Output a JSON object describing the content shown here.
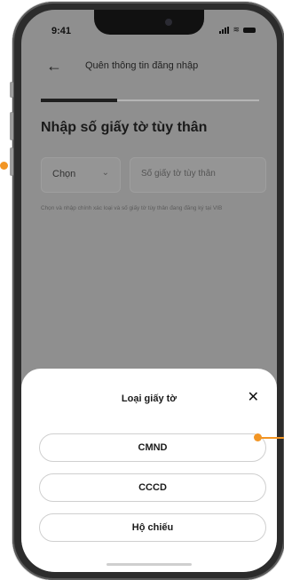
{
  "status_bar": {
    "time": "9:41"
  },
  "header": {
    "title": "Quên thông tin đăng nhập"
  },
  "progress": {
    "fraction": 0.35
  },
  "page": {
    "title": "Nhập số giấy tờ tùy thân"
  },
  "form": {
    "select_value": "Chọn",
    "input_placeholder": "Số giấy tờ tùy thân",
    "helper_text": "Chọn và nhập chính xác loại và số giấy tờ tùy thân đang đăng ký tại VIB"
  },
  "sheet": {
    "title": "Loại giấy tờ",
    "options": [
      {
        "label": "CMND"
      },
      {
        "label": "CCCD"
      },
      {
        "label": "Hộ chiếu"
      }
    ]
  },
  "icons": [
    "back-arrow-icon",
    "chevron-down-icon",
    "close-icon",
    "signal-icon",
    "wifi-icon",
    "battery-icon"
  ],
  "colors": {
    "annotation": "#f29524",
    "dim_overlay": "#8f8f8f"
  }
}
